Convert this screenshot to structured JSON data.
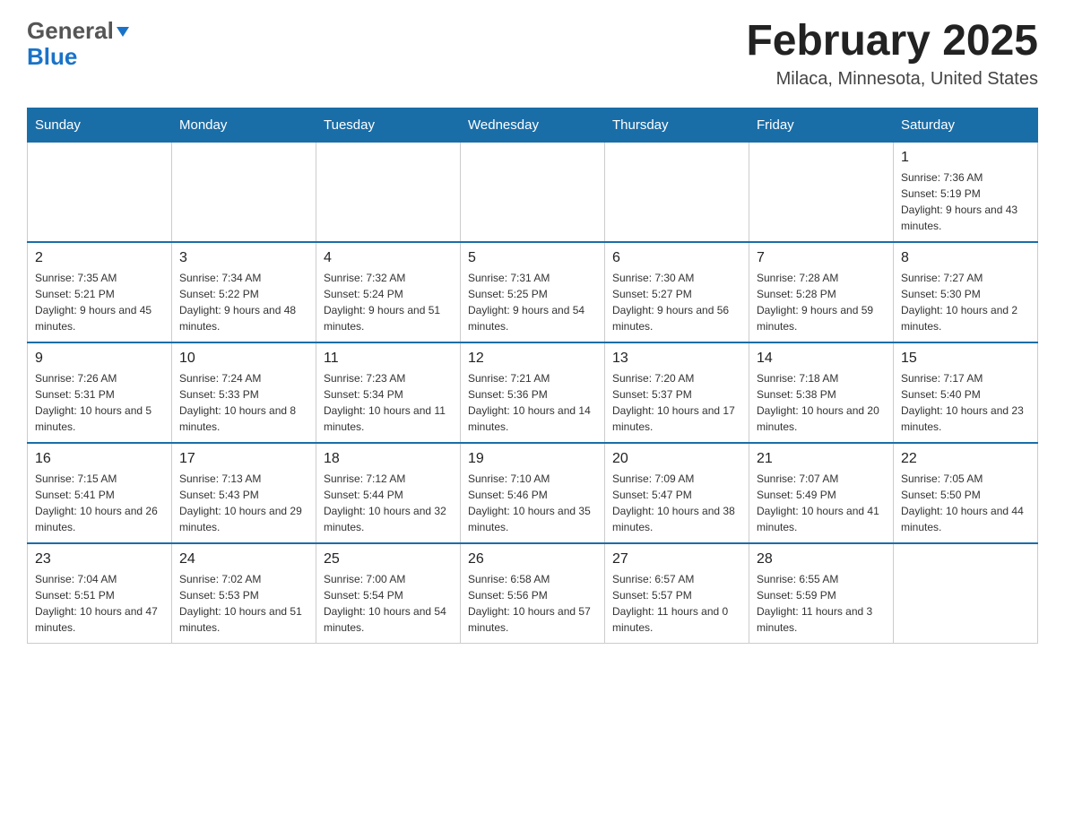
{
  "header": {
    "logo_line1": "General",
    "logo_triangle_char": "▶",
    "logo_line2": "Blue",
    "title": "February 2025",
    "subtitle": "Milaca, Minnesota, United States"
  },
  "calendar": {
    "days_of_week": [
      "Sunday",
      "Monday",
      "Tuesday",
      "Wednesday",
      "Thursday",
      "Friday",
      "Saturday"
    ],
    "weeks": [
      {
        "days": [
          {
            "number": "",
            "info": ""
          },
          {
            "number": "",
            "info": ""
          },
          {
            "number": "",
            "info": ""
          },
          {
            "number": "",
            "info": ""
          },
          {
            "number": "",
            "info": ""
          },
          {
            "number": "",
            "info": ""
          },
          {
            "number": "1",
            "info": "Sunrise: 7:36 AM\nSunset: 5:19 PM\nDaylight: 9 hours and 43 minutes."
          }
        ]
      },
      {
        "days": [
          {
            "number": "2",
            "info": "Sunrise: 7:35 AM\nSunset: 5:21 PM\nDaylight: 9 hours and 45 minutes."
          },
          {
            "number": "3",
            "info": "Sunrise: 7:34 AM\nSunset: 5:22 PM\nDaylight: 9 hours and 48 minutes."
          },
          {
            "number": "4",
            "info": "Sunrise: 7:32 AM\nSunset: 5:24 PM\nDaylight: 9 hours and 51 minutes."
          },
          {
            "number": "5",
            "info": "Sunrise: 7:31 AM\nSunset: 5:25 PM\nDaylight: 9 hours and 54 minutes."
          },
          {
            "number": "6",
            "info": "Sunrise: 7:30 AM\nSunset: 5:27 PM\nDaylight: 9 hours and 56 minutes."
          },
          {
            "number": "7",
            "info": "Sunrise: 7:28 AM\nSunset: 5:28 PM\nDaylight: 9 hours and 59 minutes."
          },
          {
            "number": "8",
            "info": "Sunrise: 7:27 AM\nSunset: 5:30 PM\nDaylight: 10 hours and 2 minutes."
          }
        ]
      },
      {
        "days": [
          {
            "number": "9",
            "info": "Sunrise: 7:26 AM\nSunset: 5:31 PM\nDaylight: 10 hours and 5 minutes."
          },
          {
            "number": "10",
            "info": "Sunrise: 7:24 AM\nSunset: 5:33 PM\nDaylight: 10 hours and 8 minutes."
          },
          {
            "number": "11",
            "info": "Sunrise: 7:23 AM\nSunset: 5:34 PM\nDaylight: 10 hours and 11 minutes."
          },
          {
            "number": "12",
            "info": "Sunrise: 7:21 AM\nSunset: 5:36 PM\nDaylight: 10 hours and 14 minutes."
          },
          {
            "number": "13",
            "info": "Sunrise: 7:20 AM\nSunset: 5:37 PM\nDaylight: 10 hours and 17 minutes."
          },
          {
            "number": "14",
            "info": "Sunrise: 7:18 AM\nSunset: 5:38 PM\nDaylight: 10 hours and 20 minutes."
          },
          {
            "number": "15",
            "info": "Sunrise: 7:17 AM\nSunset: 5:40 PM\nDaylight: 10 hours and 23 minutes."
          }
        ]
      },
      {
        "days": [
          {
            "number": "16",
            "info": "Sunrise: 7:15 AM\nSunset: 5:41 PM\nDaylight: 10 hours and 26 minutes."
          },
          {
            "number": "17",
            "info": "Sunrise: 7:13 AM\nSunset: 5:43 PM\nDaylight: 10 hours and 29 minutes."
          },
          {
            "number": "18",
            "info": "Sunrise: 7:12 AM\nSunset: 5:44 PM\nDaylight: 10 hours and 32 minutes."
          },
          {
            "number": "19",
            "info": "Sunrise: 7:10 AM\nSunset: 5:46 PM\nDaylight: 10 hours and 35 minutes."
          },
          {
            "number": "20",
            "info": "Sunrise: 7:09 AM\nSunset: 5:47 PM\nDaylight: 10 hours and 38 minutes."
          },
          {
            "number": "21",
            "info": "Sunrise: 7:07 AM\nSunset: 5:49 PM\nDaylight: 10 hours and 41 minutes."
          },
          {
            "number": "22",
            "info": "Sunrise: 7:05 AM\nSunset: 5:50 PM\nDaylight: 10 hours and 44 minutes."
          }
        ]
      },
      {
        "days": [
          {
            "number": "23",
            "info": "Sunrise: 7:04 AM\nSunset: 5:51 PM\nDaylight: 10 hours and 47 minutes."
          },
          {
            "number": "24",
            "info": "Sunrise: 7:02 AM\nSunset: 5:53 PM\nDaylight: 10 hours and 51 minutes."
          },
          {
            "number": "25",
            "info": "Sunrise: 7:00 AM\nSunset: 5:54 PM\nDaylight: 10 hours and 54 minutes."
          },
          {
            "number": "26",
            "info": "Sunrise: 6:58 AM\nSunset: 5:56 PM\nDaylight: 10 hours and 57 minutes."
          },
          {
            "number": "27",
            "info": "Sunrise: 6:57 AM\nSunset: 5:57 PM\nDaylight: 11 hours and 0 minutes."
          },
          {
            "number": "28",
            "info": "Sunrise: 6:55 AM\nSunset: 5:59 PM\nDaylight: 11 hours and 3 minutes."
          },
          {
            "number": "",
            "info": ""
          }
        ]
      }
    ]
  }
}
